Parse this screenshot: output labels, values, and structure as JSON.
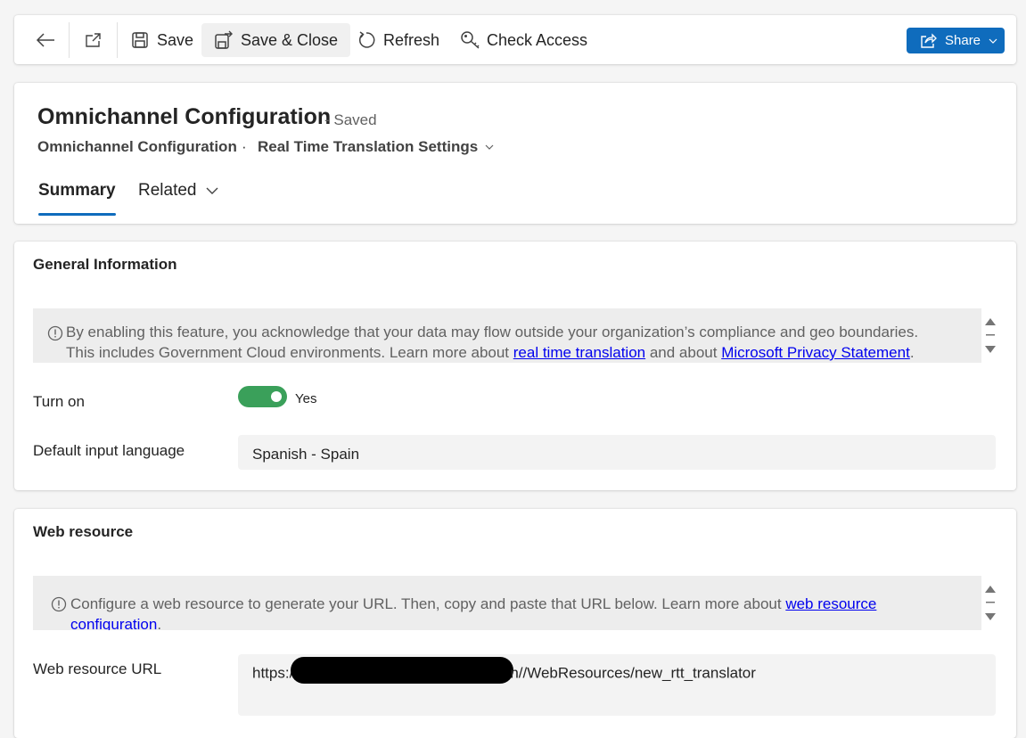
{
  "toolbar": {
    "save_label": "Save",
    "save_close_label": "Save & Close",
    "refresh_label": "Refresh",
    "check_access_label": "Check Access",
    "share_label": "Share"
  },
  "header": {
    "title": "Omnichannel Configuration",
    "status": "- Saved",
    "breadcrumb_entity": "Omnichannel Configuration",
    "breadcrumb_separator": "·",
    "breadcrumb_form": "Real Time Translation Settings",
    "tabs": [
      {
        "label": "Summary",
        "selected": true
      },
      {
        "label": "Related",
        "selected": false
      }
    ]
  },
  "general": {
    "title": "General Information",
    "notice_text_1": "By enabling this feature, you acknowledge that your data may flow outside your organization’s compliance and geo boundaries.",
    "notice_text_2": "This includes Government Cloud environments. Learn more about ",
    "notice_link_1": "real time translation",
    "notice_text_3": " and about ",
    "notice_link_2": "Microsoft Privacy Statement",
    "notice_text_4": ".",
    "turn_on_label": "Turn on",
    "turn_on_value": "Yes",
    "language_label": "Default input language",
    "language_value": "Spanish - Spain"
  },
  "web_resource": {
    "title": "Web resource",
    "notice_text_1": "Configure a web resource to generate your URL. Then, copy and paste that URL below. Learn more about ",
    "notice_link": "web resource configuration",
    "notice_text_2": ".",
    "url_label": "Web resource URL",
    "url_prefix": "https:/",
    "url_suffix": "n//WebResources/new_rtt_translator"
  },
  "colors": {
    "accent": "#0f6cbd",
    "toggle_on": "#3aa05a",
    "link": "#0000ee"
  }
}
